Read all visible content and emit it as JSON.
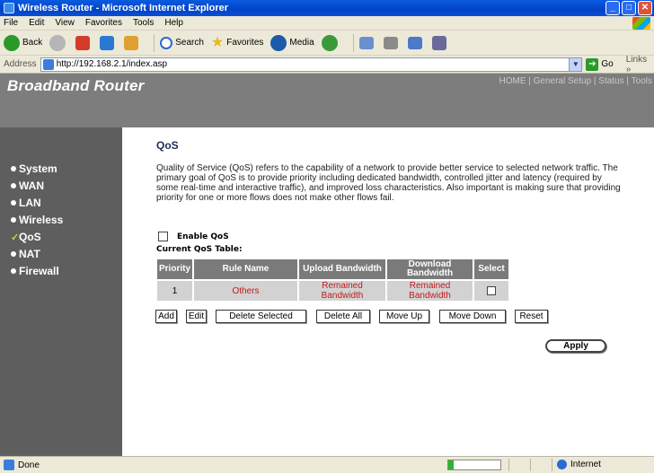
{
  "window": {
    "title": "Wireless Router - Microsoft Internet Explorer"
  },
  "menu": [
    "File",
    "Edit",
    "View",
    "Favorites",
    "Tools",
    "Help"
  ],
  "toolbar": {
    "back": "Back",
    "search": "Search",
    "favorites": "Favorites",
    "media": "Media"
  },
  "address": {
    "label": "Address",
    "url": "http://192.168.2.1/index.asp",
    "go": "Go",
    "links": "Links"
  },
  "router": {
    "brand": "Broadband Router",
    "topnav": [
      "HOME",
      "General Setup",
      "Status",
      "Tools"
    ],
    "sidebar": [
      "System",
      "WAN",
      "LAN",
      "Wireless",
      "QoS",
      "NAT",
      "Firewall"
    ],
    "active": "QoS"
  },
  "page": {
    "title": "QoS",
    "description": "Quality of Service (QoS) refers to the capability of a network to provide better service to selected network traffic. The primary goal of QoS is to provide priority including dedicated bandwidth, controlled jitter and latency (required by some real-time and interactive traffic), and improved loss characteristics. Also important is making sure that providing priority for one or more flows does not make other flows fail.",
    "enable_label": "Enable QoS",
    "table_title": "Current QoS Table:",
    "columns": [
      "Priority",
      "Rule Name",
      "Upload Bandwidth",
      "Download Bandwidth",
      "Select"
    ],
    "rows": [
      {
        "priority": "1",
        "rule_name": "Others",
        "upload": "Remained Bandwidth",
        "download": "Remained Bandwidth"
      }
    ],
    "buttons": {
      "add": "Add",
      "edit": "Edit",
      "delete_selected": "Delete Selected",
      "delete_all": "Delete All",
      "move_up": "Move Up",
      "move_down": "Move Down",
      "reset": "Reset",
      "apply": "Apply"
    }
  },
  "status": {
    "text": "Done",
    "zone": "Internet",
    "progress": 0.1
  }
}
